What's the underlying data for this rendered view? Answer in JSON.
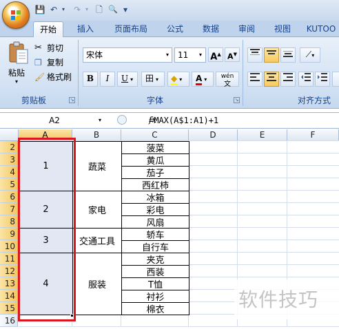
{
  "quick_access": {
    "save": "💾",
    "undo": "↶",
    "redo": "↷",
    "new": "🗋",
    "preview": "🔍",
    "customize": "▾"
  },
  "tabs": [
    "开始",
    "插入",
    "页面布局",
    "公式",
    "数据",
    "审阅",
    "视图",
    "KUTOO"
  ],
  "active_tab": "开始",
  "clipboard": {
    "paste": "粘贴",
    "cut": "剪切",
    "copy": "复制",
    "format_painter": "格式刷",
    "group": "剪贴板"
  },
  "font": {
    "name": "宋体",
    "size": "11",
    "grow": "A",
    "shrink": "A",
    "bold": "B",
    "italic": "I",
    "underline": "U",
    "border": "田",
    "fill": "◆",
    "color": "A",
    "phonetic": "wén",
    "group": "字体"
  },
  "alignment": {
    "group": "对齐方式"
  },
  "formula_bar": {
    "cell_ref": "A2",
    "fx": "fx",
    "formula": "=MAX(A$1:A1)+1"
  },
  "columns": [
    "A",
    "B",
    "C",
    "D",
    "E",
    "F"
  ],
  "rows": [
    "2",
    "3",
    "4",
    "5",
    "6",
    "7",
    "8",
    "9",
    "10",
    "11",
    "12",
    "13",
    "14",
    "15",
    "16"
  ],
  "groups": [
    {
      "num": "1",
      "category": "蔬菜",
      "items": [
        "菠菜",
        "黄瓜",
        "茄子",
        "西红柿"
      ]
    },
    {
      "num": "2",
      "category": "家电",
      "items": [
        "冰箱",
        "彩电",
        "风扇"
      ]
    },
    {
      "num": "3",
      "category": "交通工具",
      "items": [
        "轿车",
        "自行车"
      ]
    },
    {
      "num": "4",
      "category": "服装",
      "items": [
        "夹克",
        "西装",
        "T恤",
        "衬衫",
        "棉衣"
      ]
    }
  ],
  "colors": {
    "selection_outline": "#d9161e",
    "ribbon": "#d2e1f3",
    "header_selected": "#f4c762"
  },
  "watermark": "软件技巧"
}
